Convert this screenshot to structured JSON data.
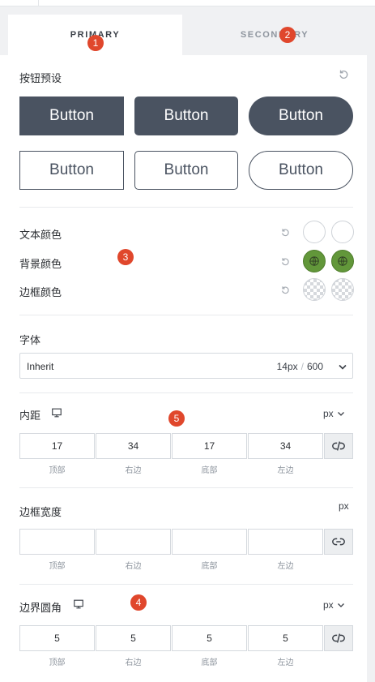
{
  "tabs": {
    "primary": "PRIMARY",
    "secondary": "SECONDARY"
  },
  "badges": [
    "1",
    "2",
    "3",
    "4",
    "5"
  ],
  "button_presets": {
    "label": "按钮预设",
    "buttons": [
      "Button",
      "Button",
      "Button",
      "Button",
      "Button",
      "Button"
    ]
  },
  "colors": {
    "text_label": "文本颜色",
    "background_label": "背景颜色",
    "border_label": "边框颜色",
    "accent_green": "#62973a",
    "button_dark": "#4a5361"
  },
  "font": {
    "label": "字体",
    "family": "Inherit",
    "size": "14px",
    "separator": "/",
    "weight": "600"
  },
  "padding": {
    "label": "内距",
    "unit": "px",
    "values": [
      "17",
      "34",
      "17",
      "34"
    ],
    "sides": [
      "顶部",
      "右边",
      "底部",
      "左边"
    ]
  },
  "border_width": {
    "label": "边框宽度",
    "unit": "px",
    "values": [
      "",
      "",
      "",
      ""
    ],
    "sides": [
      "顶部",
      "右边",
      "底部",
      "左边"
    ]
  },
  "border_radius": {
    "label": "边界圆角",
    "unit": "px",
    "values": [
      "5",
      "5",
      "5",
      "5"
    ],
    "sides": [
      "顶部",
      "右边",
      "底部",
      "左边"
    ]
  }
}
